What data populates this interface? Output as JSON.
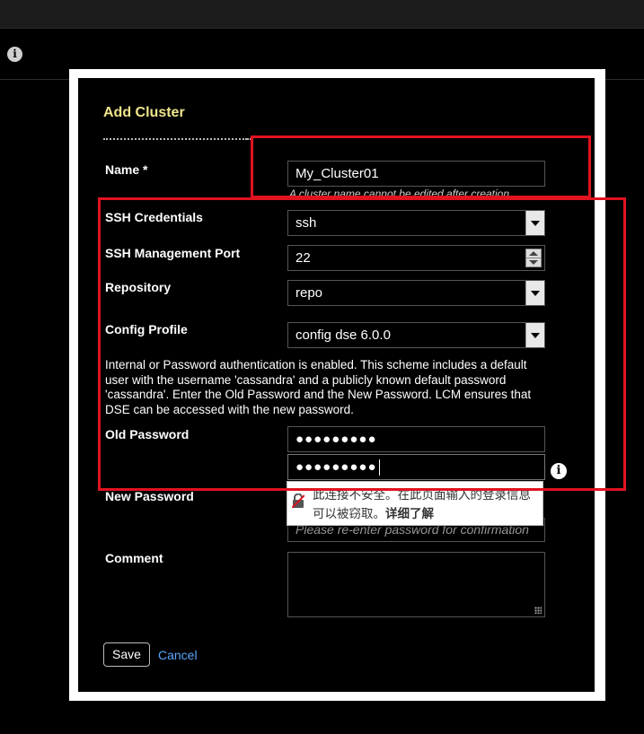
{
  "dialog": {
    "title": "Add Cluster",
    "name": {
      "label": "Name *",
      "value": "My_Cluster01",
      "hint": "A cluster name cannot be edited after creation."
    },
    "ssh_credentials": {
      "label": "SSH Credentials",
      "value": "ssh"
    },
    "ssh_port": {
      "label": "SSH Management Port",
      "value": "22"
    },
    "repository": {
      "label": "Repository",
      "value": "repo"
    },
    "config_profile": {
      "label": "Config Profile",
      "value": "config dse 6.0.0"
    },
    "auth_description": "Internal or Password authentication is enabled. This scheme includes a default user with the username 'cassandra' and a publicly known default password 'cassandra'. Enter the Old Password and the New Password. LCM ensures that DSE can be accessed with the new password.",
    "old_password": {
      "label": "Old Password",
      "masked": "●●●●●●●●●"
    },
    "new_password": {
      "label": "New Password",
      "masked": "●●●●●●●●●",
      "confirm_placeholder": "Please re-enter password for confirmation"
    },
    "comment": {
      "label": "Comment",
      "value": ""
    },
    "save_label": "Save",
    "cancel_label": "Cancel"
  },
  "insecure_warning": {
    "message": "此连接不安全。在此页面输入的登录信息可以被窃取。",
    "link": "详细了解"
  },
  "icons": {
    "top_info": "info-icon",
    "password_info": "info-icon",
    "warning": "broken-lock-icon"
  },
  "colors": {
    "title": "#f0e68c",
    "link": "#5aa8ff",
    "highlight_box": "#e0131f"
  }
}
